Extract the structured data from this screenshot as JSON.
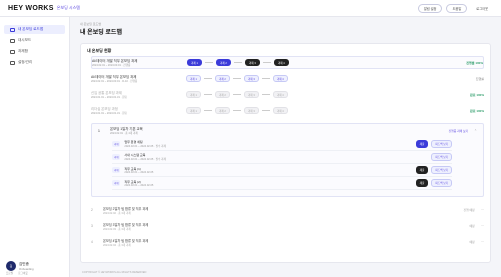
{
  "topbar": {
    "logo": "HEY WORKS",
    "logo_sub": "온보딩 시스템",
    "actions": [
      "알림 설정",
      "도움말",
      "로그아웃"
    ]
  },
  "sidebar": {
    "items": [
      {
        "label": "내 온보딩 로드맵",
        "active": true
      },
      {
        "label": "대시보드",
        "active": false
      },
      {
        "label": "과제함",
        "active": false
      },
      {
        "label": "설정/관리",
        "active": false
      }
    ],
    "user": {
      "initial": "김",
      "name": "김민종",
      "sub": "Onboarding",
      "tags": [
        "프로필",
        "로그아웃"
      ]
    }
  },
  "main": {
    "breadcrumb": "내 온보딩 로드맵",
    "title": "내 온보딩 로드맵",
    "section": "내 온보딩 현황",
    "rows": [
      {
        "name": "AI/데이터 개발 직무 온보딩 과제",
        "sub": "2024.02.01 ~ 2024.03.01 · 진행중",
        "steps": [
          "과제 1",
          "과제 2",
          "과제 3",
          "과제 4"
        ],
        "end": "진행률 100%"
      },
      {
        "name": "AI/데이터 개발 직무 온보딩 과제",
        "sub": "2024.02.01 ~ 2024.03.01 · D-10 · 진행중",
        "steps": [
          "과제 1",
          "과제 2",
          "과제 3",
          "과제 4"
        ],
        "end": "진행률"
      },
      {
        "name": "신입 공통 온보딩 과제",
        "sub": "2024.01.01 ~ 2024.01.31 · 완료",
        "steps": [
          "과제 1",
          "과제 2",
          "과제 3",
          "과제 4"
        ],
        "end": "완료 100%"
      },
      {
        "name": "리더십 온보딩 과정",
        "sub": "2024.01.01 ~ 2024.01.31 · 완료",
        "steps": [
          "과제 1",
          "과제 2",
          "과제 3",
          "과제 4"
        ],
        "end": "완료 100%"
      }
    ],
    "open": {
      "num": "1",
      "name": "온보딩 1일차 기본 교육",
      "sub": "2024.02.01 · 총 4개 과제",
      "status": "진행중 과제 보기",
      "tasks": [
        {
          "type": "과제",
          "name": "업무 환경 세팅",
          "sub": "2024.02.01 ~ 2024.02.05 · 필수 과제",
          "buttons": [
            "제출",
            "피드백 보기"
          ]
        },
        {
          "type": "과제",
          "name": "사내 시스템 교육",
          "sub": "2024.02.01 ~ 2024.02.05 · 필수 과제",
          "buttons": [
            "피드백 보기"
          ]
        },
        {
          "type": "과제",
          "name": "직무 교육 (1)",
          "sub": "2024.02.01 ~ 2024.02.05",
          "buttons": [
            "제출",
            "피드백 보기"
          ]
        },
        {
          "type": "과제",
          "name": "직무 교육 (2)",
          "sub": "2024.02.01 ~ 2024.02.05",
          "buttons": [
            "제출",
            "피드백 보기"
          ]
        }
      ]
    },
    "bullets": [
      {
        "n": "2",
        "t": "온보딩 2일차 팀 합류 및 직무 과제",
        "s": "2024.02.02 · 총 3개 과제",
        "end": "진행 예정"
      },
      {
        "n": "3",
        "t": "온보딩 3일차 팀 합류 및 직무 과제",
        "s": "2024.02.03 · 총 3개 과제",
        "end": "예정"
      },
      {
        "n": "4",
        "t": "온보딩 4일차 팀 합류 및 직무 과제",
        "s": "2024.02.04 · 총 3개 과제",
        "end": "예정"
      }
    ],
    "footer": "COPYRIGHT © HEYWORKS ALL RIGHTS RESERVED"
  }
}
